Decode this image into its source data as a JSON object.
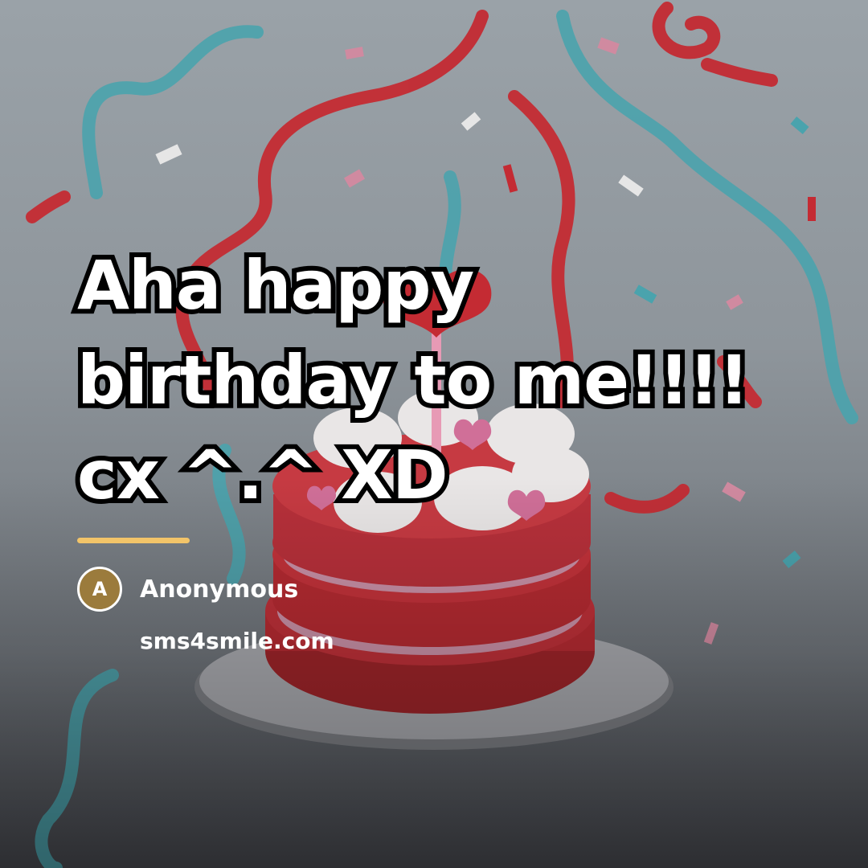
{
  "quote": {
    "text": "Aha happy birthday to me!!!! cx ^.^ XD"
  },
  "author": {
    "initial": "A",
    "name": "Anonymous"
  },
  "site": {
    "domain": "sms4smile.com"
  },
  "colors": {
    "accent_rule": "#f2c469",
    "avatar_bg": "#9b7b3c",
    "ribbon_red": "#c42b33",
    "ribbon_teal": "#4aa3ad"
  },
  "illustration": {
    "subject": "birthday-cake-with-heart-topper-and-streamers"
  }
}
